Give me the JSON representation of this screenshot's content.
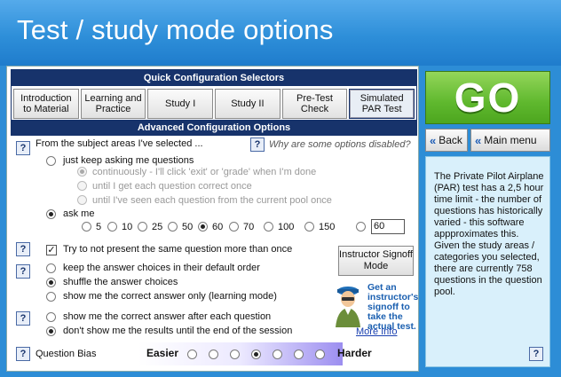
{
  "header": {
    "title": "Test / study mode options"
  },
  "quick_config": {
    "heading": "Quick Configuration Selectors",
    "buttons": [
      {
        "label": "Introduction to Material",
        "active": false
      },
      {
        "label": "Learning and Practice",
        "active": false
      },
      {
        "label": "Study I",
        "active": false
      },
      {
        "label": "Study II",
        "active": false
      },
      {
        "label": "Pre-Test Check",
        "active": false
      },
      {
        "label": "Simulated PAR Test",
        "active": true
      }
    ]
  },
  "advanced": {
    "heading": "Advanced Configuration Options",
    "help_label": "?",
    "subject_prompt": "From the subject areas I've selected ...",
    "disabled_hint": "Why are some options disabled?",
    "keep_asking": "just keep asking me questions",
    "continuously": "continuously - I'll click 'exit' or 'grade' when I'm done",
    "until_correct": "until I get each question correct once",
    "until_seen": "until I've seen each question from the current pool once",
    "ask_me": "ask me",
    "counts": [
      "5",
      "10",
      "25",
      "50",
      "60",
      "70",
      "100",
      "150"
    ],
    "selected_count": "60",
    "custom_count": "60",
    "no_repeat": "Try to not present the same question more than once",
    "no_repeat_checked": true,
    "default_order": "keep the answer choices in their default order",
    "shuffle": "shuffle the answer choices",
    "show_correct_only": "show me the correct answer only (learning mode)",
    "after_each": "show me the correct answer after each question",
    "end_session": "don't show me the results until the end of the session",
    "bias_label": "Question Bias",
    "easier": "Easier",
    "harder": "Harder",
    "bias_levels": 7,
    "bias_selected_index": 3
  },
  "signoff": {
    "button_label": "Instructor Signoff Mode",
    "icon": "instructor-figure-icon",
    "note": "Get an instructor's signoff to take the actual test.",
    "more_info": "More Info"
  },
  "actions": {
    "go": "GO",
    "back": "Back",
    "main_menu": "Main menu"
  },
  "info_box": {
    "text": "The Private Pilot Airplane (PAR) test has a 2,5 hour time limit - the number of questions has historically varied - this software appproximates this. Given the study areas / categories you selected, there are currently 758 questions in the question pool."
  },
  "colors": {
    "header_blue": "#2e8fd9",
    "section_navy": "#17336b",
    "go_green": "#5fb82e",
    "info_bg": "#d9f0fb"
  }
}
